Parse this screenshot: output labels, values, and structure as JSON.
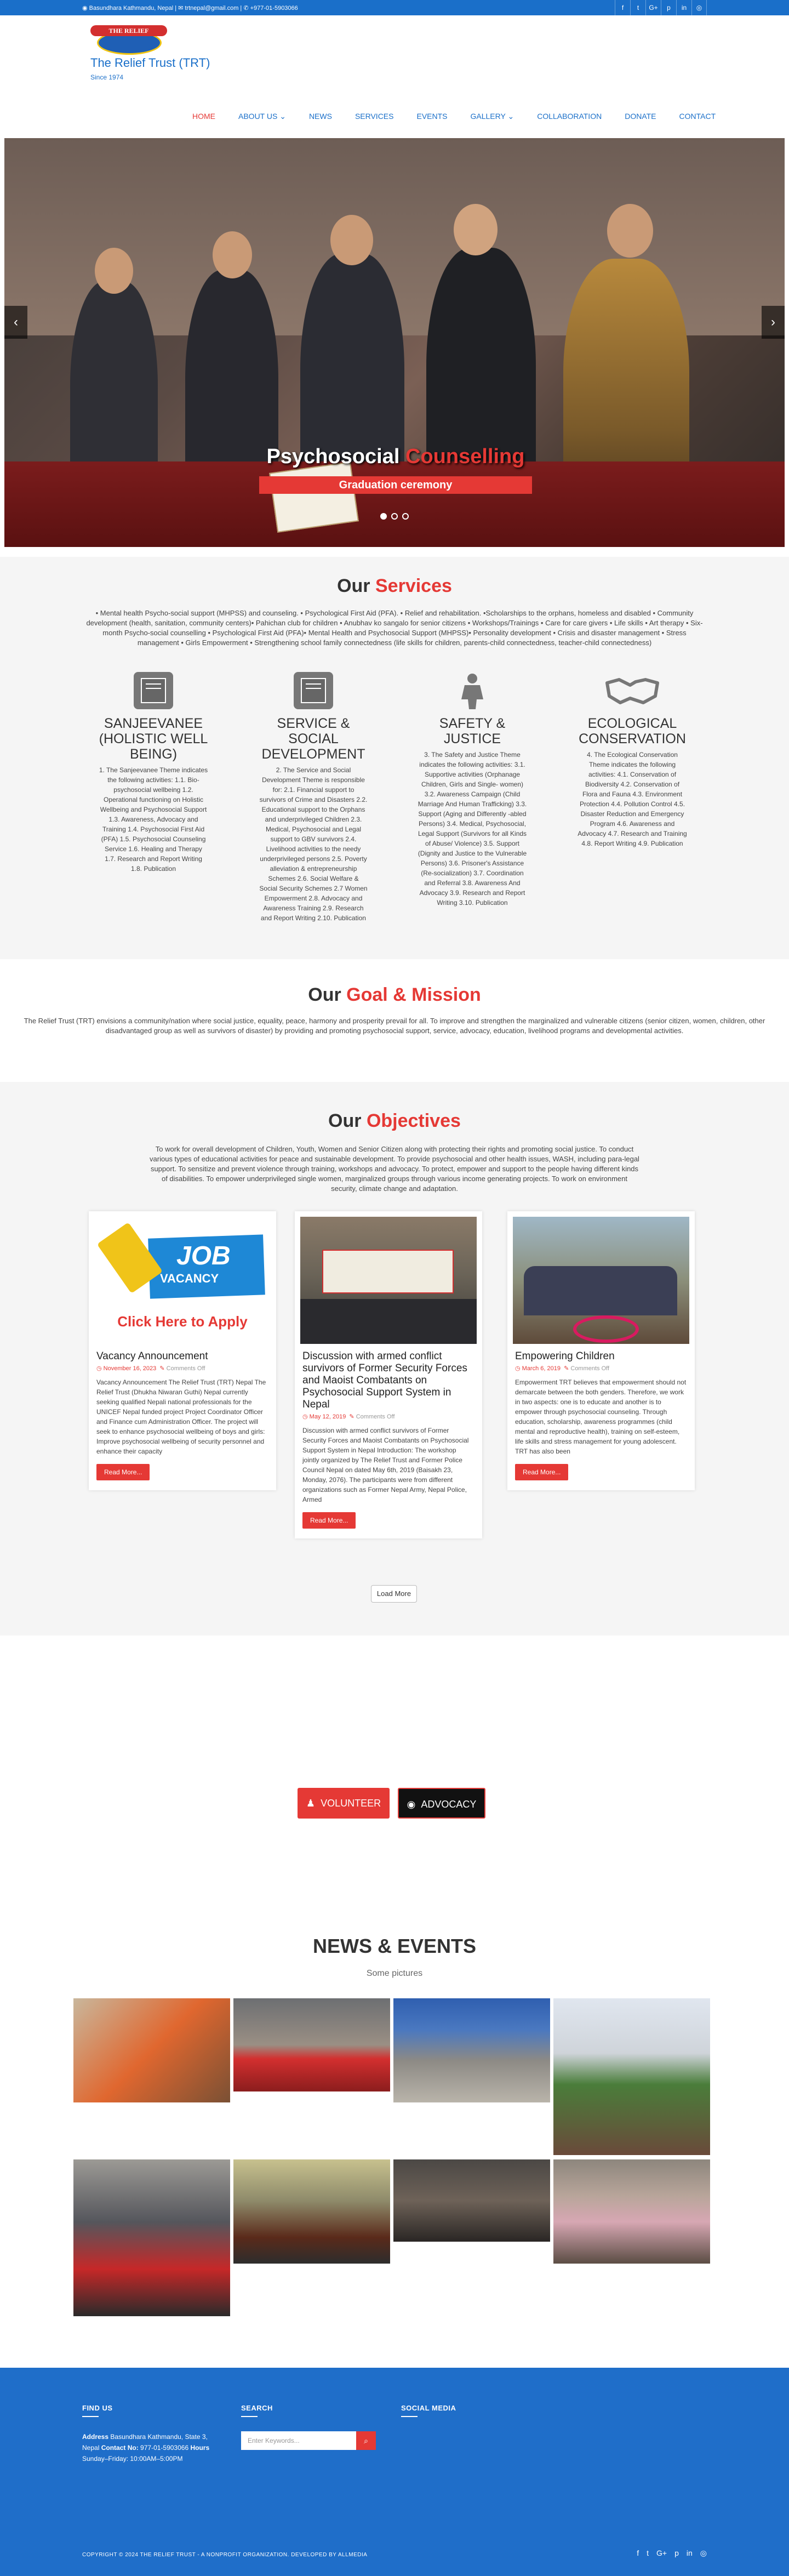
{
  "topbar": {
    "contact_text": "◉ Basundhara Kathmandu, Nepal | ✉ trtnepal@gmail.com | ✆ +977-01-5903066",
    "social_icons": [
      "facebook-icon",
      "twitter-icon",
      "google-plus-icon",
      "pinterest-icon",
      "linkedin-icon",
      "instagram-icon"
    ],
    "social_glyphs": [
      "f",
      "t",
      "G+",
      "p",
      "in",
      "◎"
    ]
  },
  "brand": {
    "ribbon": "THE RELIEF",
    "title": "The Relief Trust (TRT)",
    "since": "Since 1974"
  },
  "nav": {
    "items": [
      "HOME",
      "ABOUT US ⌄",
      "NEWS",
      "SERVICES",
      "EVENTS",
      "GALLERY ⌄",
      "COLLABORATION",
      "DONATE",
      "CONTACT"
    ],
    "active": "HOME"
  },
  "slider": {
    "title_white": "Psychosocial ",
    "title_red": "Counselling",
    "subtitle": "Graduation ceremony",
    "prev": "‹",
    "next": "›"
  },
  "services": {
    "heading_plain": "Our ",
    "heading_red": "Services",
    "intro": "• Mental health Psycho-social support (MHPSS) and counseling. • Psychological First Aid (PFA). • Relief and rehabilitation. •Scholarships to the orphans, homeless and disabled • Community development (health, sanitation, community centers)• Pahichan club for children • Anubhav ko sangalo for senior citizens • Workshops/Trainings • Care for care givers • Life skills • Art therapy • Six-month Psycho-social counselling • Psychological First Aid (PFA)• Mental Health and Psychosocial Support (MHPSS)• Personality development • Crisis and disaster management • Stress management • Girls Empowerment • Strengthening school family connectedness (life skills for children, parents-child connectedness, teacher-child connectedness)",
    "items": [
      {
        "title": "SANJEEVANEE (HOLISTIC WELL BEING)",
        "desc": "1. The Sanjeevanee Theme indicates the following activities: 1.1. Bio-psychosocial wellbeing 1.2. Operational functioning on Holistic Wellbeing and Psychosocial Support 1.3. Awareness, Advocacy and Training 1.4. Psychosocial First Aid (PFA) 1.5. Psychosocial Counseling Service 1.6. Healing and Therapy 1.7. Research and Report Writing 1.8. Publication",
        "icon": "book-icon"
      },
      {
        "title": "SERVICE & SOCIAL DEVELOPMENT",
        "desc": "2. The Service and Social Development Theme is responsible for: 2.1. Financial support to survivors of Crime and Disasters 2.2. Educational support to the Orphans and underprivileged Children 2.3. Medical, Psychosocial and Legal support to GBV survivors 2.4. Livelihood activities to the needy underprivileged persons 2.5. Poverty alleviation & entrepreneurship Schemes 2.6. Social Welfare & Social Security Schemes 2.7 Women Empowerment 2.8. Advocacy and Awareness Training 2.9. Research and Report Writing 2.10. Publication",
        "icon": "book-icon"
      },
      {
        "title": "SAFETY & JUSTICE",
        "desc": "3. The Safety and Justice Theme indicates the following activities: 3.1. Supportive activities (Orphanage Children, Girls and Single- women) 3.2. Awareness Campaign (Child Marriage And Human Trafficking) 3.3. Support (Aging and Differently -abled Persons) 3.4. Medical, Psychosocial, Legal Support (Survivors for all Kinds of Abuse/ Violence) 3.5. Support (Dignity and Justice to the Vulnerable Persons) 3.6. Prisoner's Assistance (Re-socialization) 3.7. Coordination and Referral 3.8. Awareness And Advocacy 3.9. Research and Report Writing 3.10. Publication",
        "icon": "person-icon"
      },
      {
        "title": "ECOLOGICAL CONSERVATION",
        "desc": "4. The Ecological Conservation Theme indicates the following activities: 4.1. Conservation of Biodiversity 4.2. Conservation of Flora and Fauna 4.3. Environment Protection 4.4. Pollution Control 4.5. Disaster Reduction and Emergency Program 4.6. Awareness and Advocacy 4.7. Research and Training 4.8. Report Writing 4.9. Publication",
        "icon": "handshake-icon"
      }
    ]
  },
  "goal": {
    "heading_plain": "Our ",
    "heading_red": "Goal & Mission",
    "text": "The Relief Trust (TRT) envisions a community/nation where social justice, equality, peace, harmony and prosperity prevail for all. To improve and strengthen the marginalized and vulnerable citizens (senior citizen, women, children, other disadvantaged group as well as survivors of disaster) by providing and promoting psychosocial support, service, advocacy, education, livelihood programs and developmental activities."
  },
  "objectives": {
    "heading_plain": "Our ",
    "heading_red": "Objectives",
    "text": "To work for overall development of Children, Youth, Women and Senior Citizen along with protecting their rights and promoting social justice. To conduct various types of educational activities for peace and sustainable development. To provide psychosocial and other health issues, WASH, including para-legal support. To sensitize and prevent violence through training, workshops and advocacy. To protect, empower and support to the people having different kinds of disabilities. To empower underprivileged single women, marginalized groups through various income generating projects. To work on environment security, climate change and adaptation.",
    "posts": [
      {
        "title": "Vacancy Announcement",
        "date": "November 16, 2023",
        "comments": "Comments Off",
        "excerpt": "Vacancy Announcement The Relief Trust (TRT) Nepal The Relief Trust (Dhukha Niwaran Guthi) Nepal currently seeking qualified Nepali national professionals for the UNICEF Nepal funded project Project Coordinator Officer and Finance cum Administration Officer. The project will seek to enhance psychosocial wellbeing of boys and girls: Improve psychosocial wellbeing of security personnel and enhance their capacity",
        "button": "Read More...",
        "img_job": "JOB",
        "img_vacancy": "VACANCY",
        "img_cta": "Click Here to Apply"
      },
      {
        "title": "Discussion with armed conflict survivors of Former Security Forces and Maoist Combatants on Psychosocial Support System in Nepal",
        "date": "May 12, 2019",
        "comments": "Comments Off",
        "excerpt": "Discussion with armed conflict survivors of Former Security Forces and Maoist Combatants on Psychosocial Support System in Nepal Introduction: The workshop jointly organized by The Relief Trust and Former Police Council Nepal on dated May 6th, 2019 (Baisakh 23, Monday, 2076). The participants were from different organizations such as Former Nepal Army, Nepal Police, Armed",
        "button": "Read More..."
      },
      {
        "title": "Empowering Children",
        "date": "March 6, 2019",
        "comments": "Comments Off",
        "excerpt": "Empowerment TRT believes that empowerment should not demarcate between the both genders. Therefore, we work in two aspects: one is to educate and another is to empower through psychosocial counseling. Through education, scholarship, awareness programmes (child mental and reproductive health), training on self-esteem, life skills and stress management for young adolescent. TRT has also been",
        "button": "Read More..."
      }
    ],
    "load_more": "Load More"
  },
  "cta": {
    "volunteer": "VOLUNTEER",
    "advocacy": "ADVOCACY",
    "volunteer_glyph": "♟",
    "advocacy_glyph": "◉"
  },
  "news": {
    "heading": "NEWS & EVENTS",
    "subheading": "Some pictures"
  },
  "footer": {
    "find_us": "FIND US",
    "search": "SEARCH",
    "social": "SOCIAL MEDIA",
    "address_label": "Address",
    "address": "Basundhara Kathmandu, State 3, Nepal",
    "contact_label": "Contact No:",
    "contact": "977-01-5903066",
    "hours_label": "Hours",
    "hours": "Sunday–Friday: 10:00AM–5:00PM",
    "search_placeholder": "Enter Keywords...",
    "search_button": "⌕",
    "copyright": "COPYRIGHT © 2024 THE RELIEF TRUST - A NONPROFIT ORGANIZATION. DEVELOPED BY ALLMEDIA",
    "social_glyphs": [
      "f",
      "t",
      "G+",
      "p",
      "in",
      "◎"
    ]
  },
  "colors": {
    "accent": "#e53935",
    "brand": "#1a6fc9",
    "footer": "#1f6ec9"
  }
}
